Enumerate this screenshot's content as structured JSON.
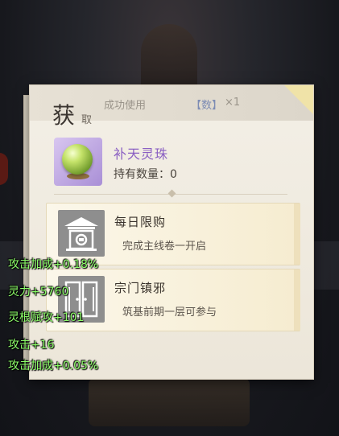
{
  "popup": {
    "title_big": "获",
    "title_small": "取",
    "success_text": "成功使用",
    "item_ref": "【数】",
    "qty_text": "×1"
  },
  "item": {
    "name": "补天灵珠",
    "holding_label": "持有数量：0",
    "icon": "green-orb-icon"
  },
  "sources": [
    {
      "title": "每日限购",
      "subtitle": "完成主线卷一开启",
      "icon": "shop-pavilion-icon"
    },
    {
      "title": "宗门镇邪",
      "subtitle": "筑基前期一层可参与",
      "icon": "gate-door-icon"
    }
  ],
  "buffs": [
    "攻击加成+0.18%",
    "灵力+5760",
    "灵根赋攻+101",
    "攻击+16",
    "攻击加成+0.05%"
  ],
  "colors": {
    "buff_text": "#8dff6a",
    "item_name": "#8a5fc2",
    "panel_bg": "#f3efe6"
  }
}
